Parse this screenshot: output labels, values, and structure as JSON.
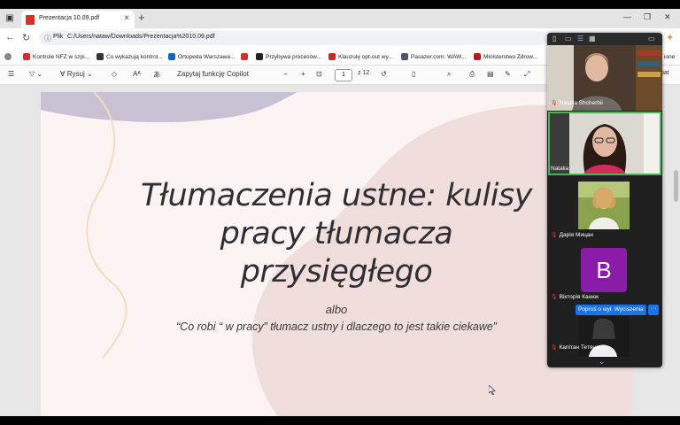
{
  "browser": {
    "tab": {
      "title": "Prezentacja 10.09.pdf"
    },
    "address": {
      "label": "Plik",
      "url": "C:/Users/nataw/Downloads/Prezentacja%2010.09.pdf"
    },
    "bookmarks": [
      {
        "label": "Kontrole NFZ w szpi...",
        "color": "#d32f2f"
      },
      {
        "label": "Co wykazują kontrol...",
        "color": "#333333"
      },
      {
        "label": "Ortopeda Warszawa...",
        "color": "#1565c0"
      },
      {
        "label": "",
        "color": "#d32f2f"
      },
      {
        "label": "Przybywa procesów...",
        "color": "#222222"
      },
      {
        "label": "Klauzulę opt-out wy...",
        "color": "#c62828"
      },
      {
        "label": "Pasazer.com: WAW...",
        "color": "#455a64"
      },
      {
        "label": "Ministerstwo Zdrow...",
        "color": "#b71c1c"
      }
    ],
    "bookmarks_overflow": "ione"
  },
  "pdf_toolbar": {
    "draw_label": "Rysuj",
    "copilot_label": "Zapytaj funkcję Copilot",
    "page_current": "1",
    "page_total": "z 12",
    "overflow_text": "bat"
  },
  "slide": {
    "title_line1": "Tłumaczenia ustne: kulisy",
    "title_line2": "pracy tłumacza",
    "title_line3": "przysięgłego",
    "albo": "albo",
    "subtitle": "“Co robi “ w pracy” tłumacz ustny i dlaczego to jest takie ciekawe”"
  },
  "meeting": {
    "participants": [
      {
        "name": "Natalia Shcherbii",
        "muted": true
      },
      {
        "name": "Natalia",
        "muted": false,
        "active_speaker": true
      },
      {
        "name": "Дарія Мицан",
        "muted": true
      },
      {
        "name": "Вікторія Канюк",
        "muted": true,
        "initial": "B"
      },
      {
        "name": "Капітан Тетяна",
        "muted": true
      }
    ],
    "raise_hand_label": "Poproś o wył. Wyciszenia",
    "more_label": "···"
  },
  "colors": {
    "slide_bg": "#fbf4f2",
    "blob_pink": "#f0dedd",
    "blob_lavender": "#c9c2d4",
    "squiggle": "#f2dcc4",
    "active_border": "#3fb950",
    "avatar_purple": "#8b1ca8",
    "raise_blue": "#1a73e8"
  }
}
